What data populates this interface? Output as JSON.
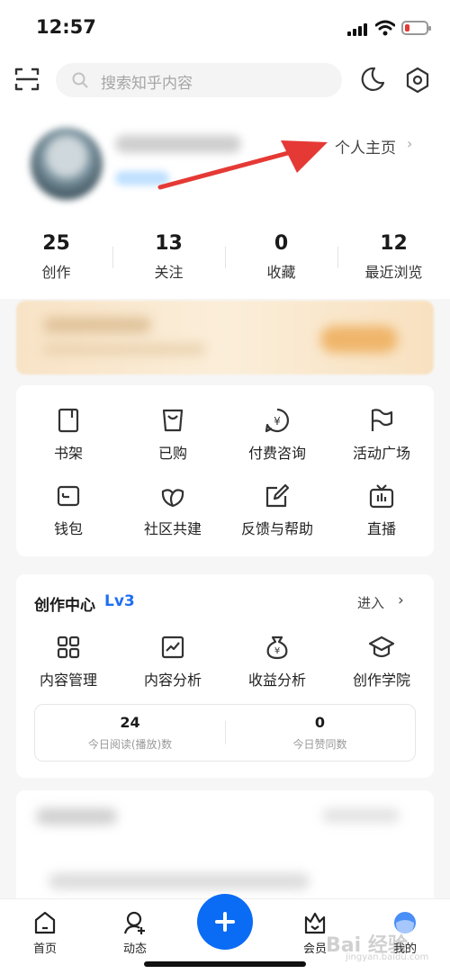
{
  "status_bar": {
    "time": "12:57"
  },
  "header": {
    "search_placeholder": "搜索知乎内容"
  },
  "profile": {
    "home_link": "个人主页",
    "chevron": "›"
  },
  "stats": [
    {
      "value": "25",
      "label": "创作"
    },
    {
      "value": "13",
      "label": "关注"
    },
    {
      "value": "0",
      "label": "收藏"
    },
    {
      "value": "12",
      "label": "最近浏览"
    }
  ],
  "tools": [
    {
      "label": "书架",
      "icon": "bookshelf-icon"
    },
    {
      "label": "已购",
      "icon": "purchased-bag-icon"
    },
    {
      "label": "付费咨询",
      "icon": "paid-consult-icon"
    },
    {
      "label": "活动广场",
      "icon": "flag-icon"
    },
    {
      "label": "钱包",
      "icon": "wallet-icon"
    },
    {
      "label": "社区共建",
      "icon": "community-icon"
    },
    {
      "label": "反馈与帮助",
      "icon": "feedback-icon"
    },
    {
      "label": "直播",
      "icon": "live-tv-icon"
    }
  ],
  "creation_center": {
    "title": "创作中心",
    "level": "Lv3",
    "enter": "进入",
    "enter_chevron": "›",
    "items": [
      {
        "label": "内容管理",
        "icon": "grid-icon"
      },
      {
        "label": "内容分析",
        "icon": "chart-icon"
      },
      {
        "label": "收益分析",
        "icon": "money-bag-icon"
      },
      {
        "label": "创作学院",
        "icon": "graduation-cap-icon"
      }
    ],
    "today": [
      {
        "value": "24",
        "label": "今日阅读(播放)数"
      },
      {
        "value": "0",
        "label": "今日赞同数"
      }
    ]
  },
  "tabbar": {
    "items": [
      {
        "label": "首页",
        "icon": "home-icon"
      },
      {
        "label": "动态",
        "icon": "activity-icon"
      },
      {
        "label": "会员",
        "icon": "vip-crown-icon"
      },
      {
        "label": "我的",
        "icon": "me-avatar-icon"
      }
    ]
  },
  "watermark": {
    "text": "Bai 经验",
    "sub": "jingyan.baidu.com"
  },
  "colors": {
    "accent": "#0a6cf5",
    "level": "#1f6ff2",
    "arrow": "#e53935"
  }
}
